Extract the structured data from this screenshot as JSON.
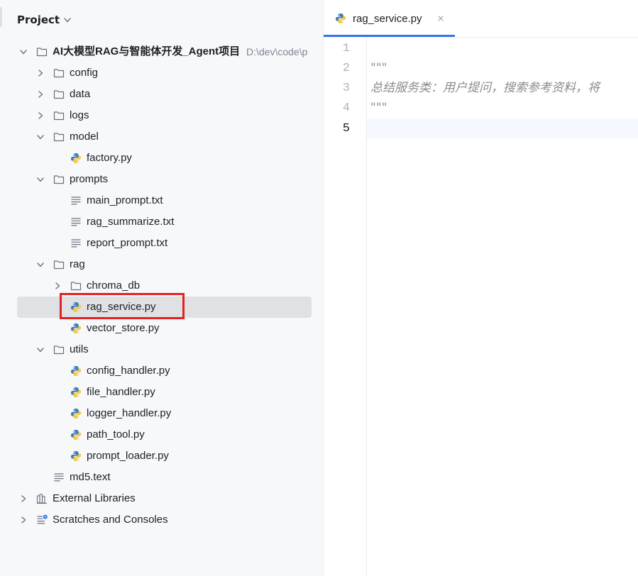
{
  "panel": {
    "title": "Project"
  },
  "tree": {
    "root": {
      "label": "AI大模型RAG与智能体开发_Agent项目",
      "path": "D:\\dev\\code\\p"
    },
    "config": "config",
    "data": "data",
    "logs": "logs",
    "model": "model",
    "model_factory": "factory.py",
    "prompts": "prompts",
    "prompts_main": "main_prompt.txt",
    "prompts_rag": "rag_summarize.txt",
    "prompts_report": "report_prompt.txt",
    "rag": "rag",
    "rag_chroma": "chroma_db",
    "rag_service": "rag_service.py",
    "rag_vector": "vector_store.py",
    "utils": "utils",
    "utils_config": "config_handler.py",
    "utils_file": "file_handler.py",
    "utils_logger": "logger_handler.py",
    "utils_path": "path_tool.py",
    "utils_prompt": "prompt_loader.py",
    "md5": "md5.text",
    "external_libraries": "External Libraries",
    "scratches": "Scratches and Consoles"
  },
  "editor": {
    "tab_label": "rag_service.py",
    "line_numbers": [
      "1",
      "2",
      "3",
      "4",
      "5"
    ],
    "lines": [
      "",
      "\"\"\"",
      "总结服务类：用户提问，搜索参考资料，将",
      "\"\"\"",
      ""
    ]
  },
  "colors": {
    "accent": "#3574f0",
    "highlight_box": "#e52121",
    "selection": "#dfe1e5",
    "comment": "#8c8c8c"
  }
}
